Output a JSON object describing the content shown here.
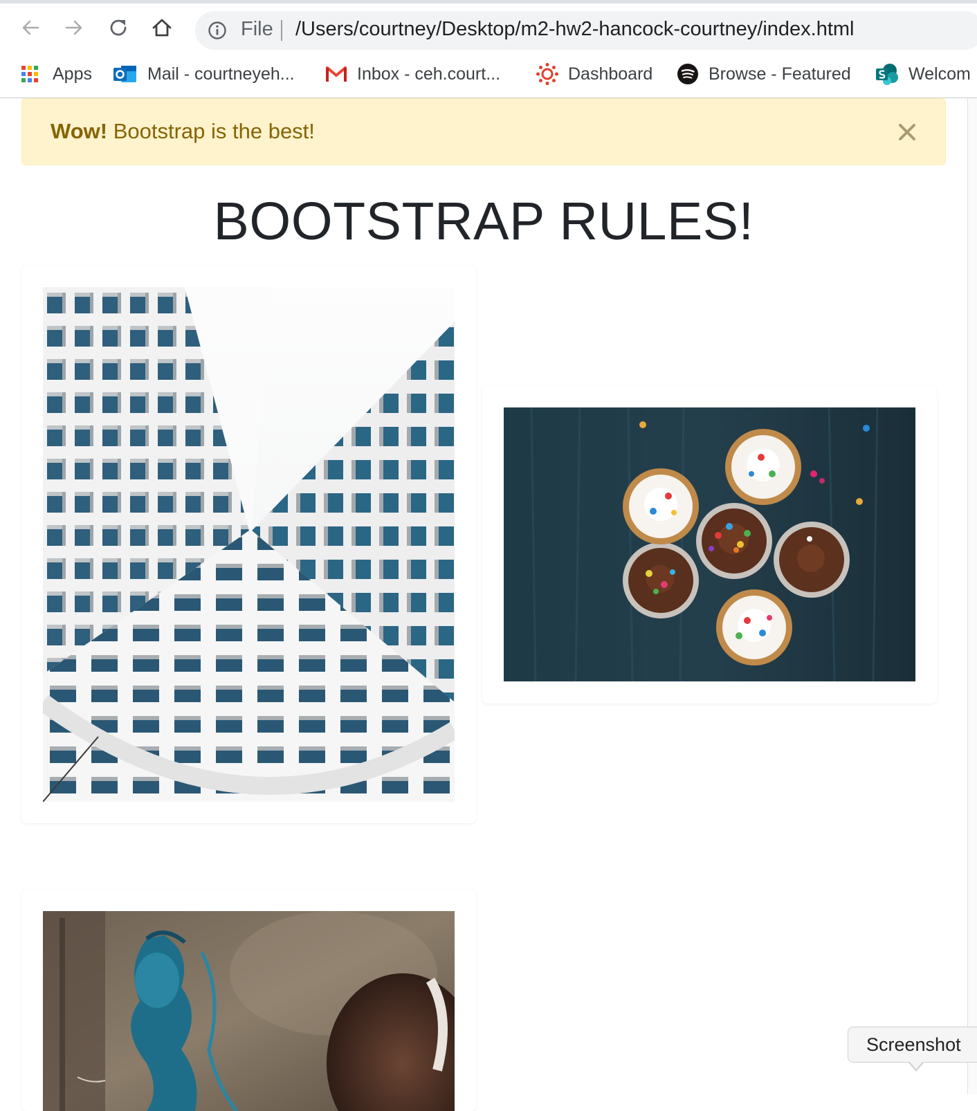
{
  "browser": {
    "back_icon": "arrow-left-icon",
    "forward_icon": "arrow-right-icon",
    "reload_icon": "reload-icon",
    "home_icon": "home-icon",
    "info_icon": "info-icon",
    "scheme": "File",
    "url": "/Users/courtney/Desktop/m2-hw2-hancock-courtney/index.html"
  },
  "bookmarks": [
    {
      "label": "Apps",
      "icon": "apps-grid-icon"
    },
    {
      "label": "Mail - courtneyeh...",
      "icon": "outlook-icon"
    },
    {
      "label": "Inbox - ceh.court...",
      "icon": "gmail-icon"
    },
    {
      "label": "Dashboard",
      "icon": "canvas-icon"
    },
    {
      "label": "Browse - Featured",
      "icon": "spotify-icon"
    },
    {
      "label": "Welcom",
      "icon": "sharepoint-icon"
    }
  ],
  "alert": {
    "strong": "Wow!",
    "text": " Bootstrap is the best!",
    "close_icon": "close-icon",
    "colors": {
      "background": "#fff3cd",
      "border": "#ffeeba",
      "text": "#856404"
    }
  },
  "page": {
    "heading": "BOOTSTRAP RULES!"
  },
  "cards": [
    {
      "image": "building-photo"
    },
    {
      "image": "cupcakes-photo"
    },
    {
      "image": "graffiti-photo"
    }
  ],
  "tooltip": {
    "label": "Screenshot"
  }
}
